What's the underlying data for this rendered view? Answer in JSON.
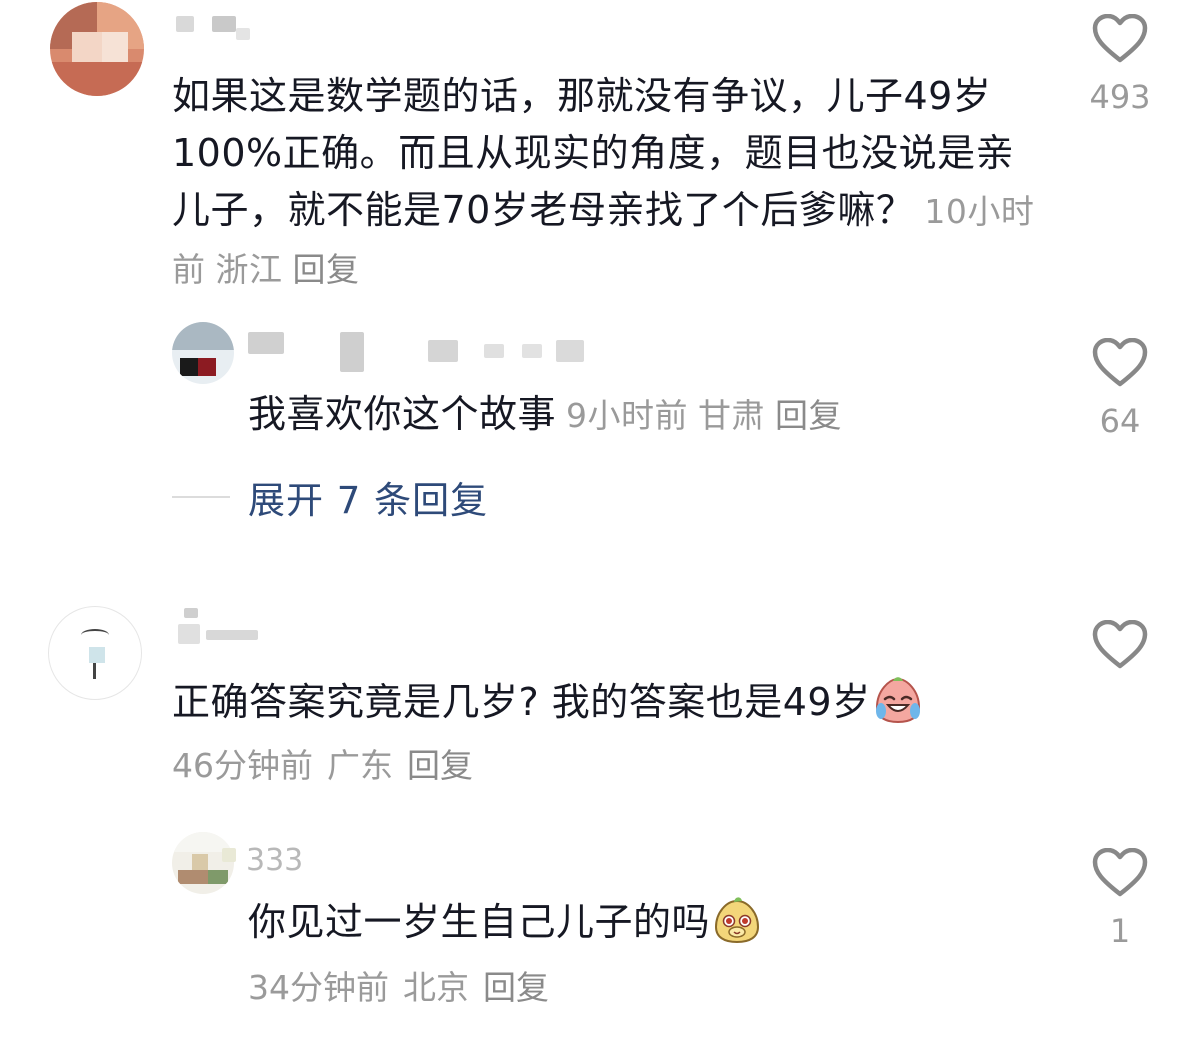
{
  "comments": [
    {
      "text": "如果这是数学题的话，那就没有争议，儿子49岁100%正确。而且从现实的角度，题目也没说是亲儿子，就不能是70岁老母亲找了个后爹嘛？",
      "time": "10小时前",
      "location": "浙江",
      "reply_label": "回复",
      "likes": "493",
      "reply": {
        "text": "我喜欢你这个故事",
        "time": "9小时前",
        "location": "甘肃",
        "reply_label": "回复",
        "likes": "64"
      },
      "expand_label": "展开 7 条回复"
    },
    {
      "text": "正确答案究竟是几岁? 我的答案也是49岁",
      "emoji": "crying-laughing-emoji",
      "time": "46分钟前",
      "location": "广东",
      "reply_label": "回复",
      "likes": "",
      "reply": {
        "username_tail": "333",
        "text": "你见过一岁生自己儿子的吗",
        "emoji": "smirk-emoji",
        "time": "34分钟前",
        "location": "北京",
        "reply_label": "回复",
        "likes": "1"
      }
    }
  ],
  "colors": {
    "text": "#161823",
    "meta": "#9a9a9a",
    "link": "#2e4a79",
    "icon": "#888888"
  }
}
